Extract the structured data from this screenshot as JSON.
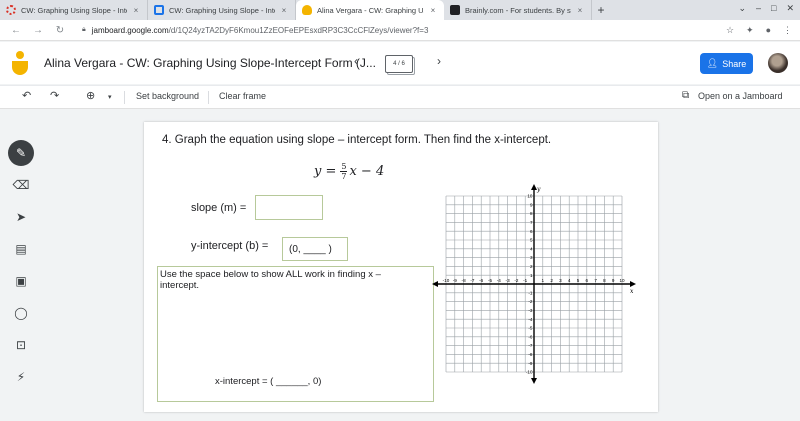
{
  "tabs": [
    {
      "title": "CW: Graphing Using Slope - Intercept",
      "icon": "circle-favicon",
      "color": "#d93025",
      "active": false
    },
    {
      "title": "CW: Graphing Using Slope - Intercept",
      "icon": "classroom-favicon",
      "color": "#1a73e8",
      "active": false
    },
    {
      "title": "Alina Vergara - CW: Graphing Using Slope",
      "icon": "jamboard-favicon",
      "color": "#f4b400",
      "active": true
    },
    {
      "title": "Brainly.com - For students. By students.",
      "icon": "brainly-favicon",
      "color": "#202124",
      "active": false
    }
  ],
  "tab_close": "×",
  "new_tab": "+",
  "address": {
    "url_host": "jamboard.google.com",
    "url_path": "/d/1Q24yzTA2DyF6Kmou1ZzEOFeEPEsxdRP3C3CcCFlZeys/viewer?f=3"
  },
  "header": {
    "title": "Alina Vergara - CW: Graphing Using Slope-Intercept Form (J...",
    "frame_counter": "4 / 6",
    "share_label": "Share"
  },
  "toolbar": {
    "set_background": "Set background",
    "clear_frame": "Clear frame",
    "open_jamboard": "Open on a Jamboard"
  },
  "worksheet": {
    "question": "4.   Graph the equation using slope – intercept form.  Then find the x-intercept.",
    "eq_lhs": "y =",
    "eq_num": "5",
    "eq_den": "7",
    "eq_rhs": "x − 4",
    "slope_label": "slope (m) =",
    "slope_value": "",
    "yint_label": "y-intercept (b) =",
    "yint_value": "(0, ____ )",
    "work_instructions": "Use the space below to show ALL work in finding x – intercept.",
    "xint_label": "x-intercept = ( ______, 0)"
  },
  "graph": {
    "x_label": "x",
    "y_label": "y",
    "x_ticks": [
      -10,
      -9,
      -8,
      -7,
      -6,
      -5,
      -4,
      -3,
      -2,
      -1,
      1,
      2,
      3,
      4,
      5,
      6,
      7,
      8,
      9,
      10
    ],
    "y_ticks": [
      10,
      9,
      8,
      7,
      6,
      5,
      4,
      3,
      2,
      1,
      -1,
      -2,
      -3,
      -4,
      -5,
      -6,
      -7,
      -8,
      -9,
      -10
    ]
  }
}
